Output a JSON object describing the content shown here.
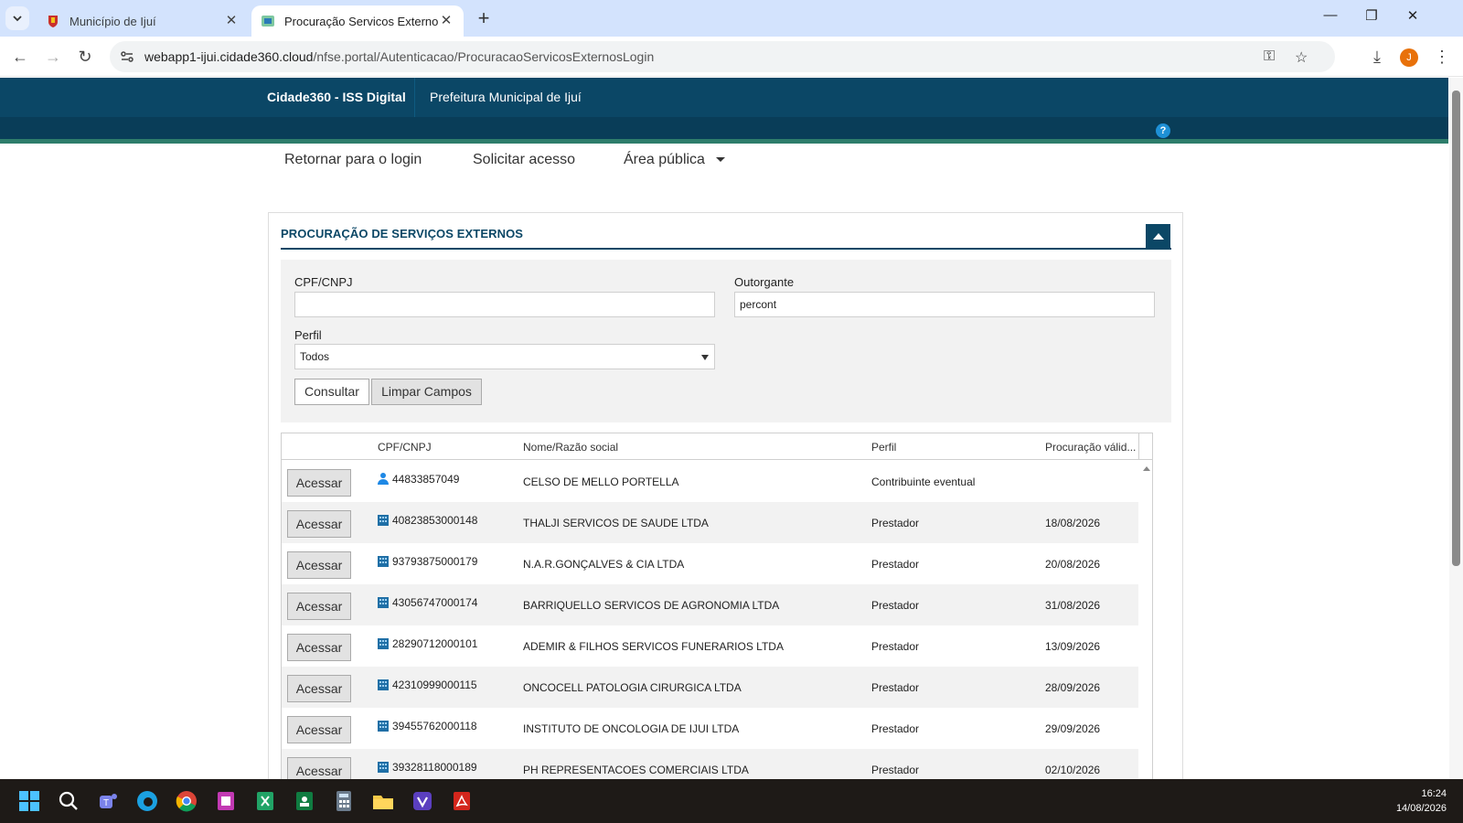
{
  "browser": {
    "tabs": [
      {
        "title": "Município de Ijuí",
        "active": false
      },
      {
        "title": "Procuração Servicos Externos",
        "active": true
      }
    ],
    "url_host": "webapp1-ijui.cidade360.cloud",
    "url_path": "/nfse.portal/Autenticacao/ProcuracaoServicosExternosLogin",
    "profile_initial": "J"
  },
  "header": {
    "brand": "Cidade360 - ISS Digital",
    "prefecture": "Prefeitura Municipal de Ijuí",
    "help": "?"
  },
  "topnav": {
    "return_login": "Retornar para o login",
    "request_access": "Solicitar acesso",
    "public_area": "Área pública"
  },
  "panel": {
    "title": "PROCURAÇÃO DE SERVIÇOS EXTERNOS",
    "filters": {
      "cpf_label": "CPF/CNPJ",
      "cpf_value": "",
      "outorgante_label": "Outorgante",
      "outorgante_value": "percont",
      "perfil_label": "Perfil",
      "perfil_value": "Todos",
      "consultar": "Consultar",
      "limpar": "Limpar Campos"
    },
    "grid": {
      "columns": [
        "CPF/CNPJ",
        "Nome/Razão social",
        "Perfil",
        "Procuração válid..."
      ],
      "action_label": "Acessar",
      "rows": [
        {
          "doc": "44833857049",
          "name": "CELSO DE MELLO PORTELLA",
          "perfil": "Contribuinte eventual",
          "valid": "",
          "icon": "person-icon"
        },
        {
          "doc": "40823853000148",
          "name": "THALJI SERVICOS DE SAUDE LTDA",
          "perfil": "Prestador",
          "valid": "18/08/2026",
          "icon": "building-icon"
        },
        {
          "doc": "93793875000179",
          "name": "N.A.R.GONÇALVES & CIA LTDA",
          "perfil": "Prestador",
          "valid": "20/08/2026",
          "icon": "building-icon"
        },
        {
          "doc": "43056747000174",
          "name": "BARRIQUELLO SERVICOS DE AGRONOMIA LTDA",
          "perfil": "Prestador",
          "valid": "31/08/2026",
          "icon": "building-icon"
        },
        {
          "doc": "28290712000101",
          "name": "ADEMIR & FILHOS SERVICOS FUNERARIOS LTDA",
          "perfil": "Prestador",
          "valid": "13/09/2026",
          "icon": "building-icon"
        },
        {
          "doc": "42310999000115",
          "name": "ONCOCELL PATOLOGIA CIRURGICA LTDA",
          "perfil": "Prestador",
          "valid": "28/09/2026",
          "icon": "building-icon"
        },
        {
          "doc": "39455762000118",
          "name": "INSTITUTO DE ONCOLOGIA DE IJUI LTDA",
          "perfil": "Prestador",
          "valid": "29/09/2026",
          "icon": "building-icon"
        },
        {
          "doc": "39328118000189",
          "name": "PH REPRESENTACOES COMERCIAIS LTDA",
          "perfil": "Prestador",
          "valid": "02/10/2026",
          "icon": "building-icon"
        }
      ]
    }
  },
  "taskbar": {
    "time": "16:24",
    "date": "14/08/2026"
  },
  "colors": {
    "header_dark": "#0b4766",
    "header_stripe": "#2e7d6b",
    "accent_blue": "#1e90d6"
  }
}
